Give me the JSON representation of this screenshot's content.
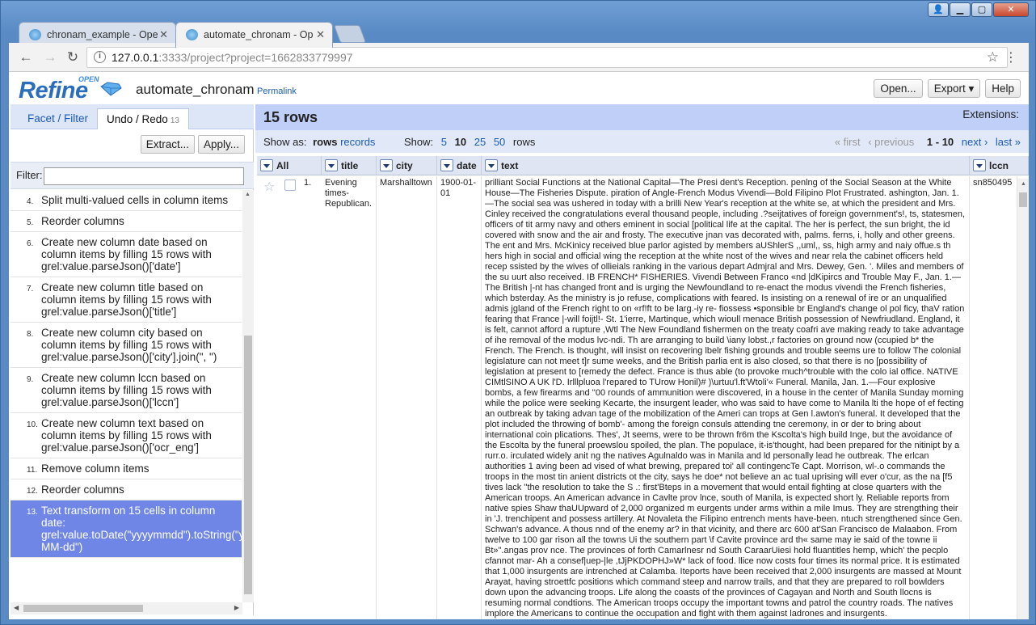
{
  "browser": {
    "tabs": [
      {
        "title": "chronam_example - Ope"
      },
      {
        "title": "automate_chronam - Op"
      }
    ],
    "address": {
      "host": "127.0.0.1",
      "path": ":3333/project?project=1662833779997"
    }
  },
  "header": {
    "logo_text": "Refine",
    "logo_super": "OPEN",
    "project_name": "automate_chronam",
    "permalink": "Permalink",
    "buttons": {
      "open": "Open...",
      "export": "Export ▾",
      "help": "Help"
    }
  },
  "left": {
    "tabs": {
      "facet": "Facet / Filter",
      "undo": "Undo / Redo",
      "undo_count": "13"
    },
    "extract": "Extract...",
    "apply": "Apply...",
    "filter_label": "Filter:",
    "history": [
      {
        "num": "4.",
        "text": "Split multi-valued cells in column items"
      },
      {
        "num": "5.",
        "text": "Reorder columns"
      },
      {
        "num": "6.",
        "text": "Create new column date based on column items by filling 15 rows with grel:value.parseJson()['date']"
      },
      {
        "num": "7.",
        "text": "Create new column title based on column items by filling 15 rows with grel:value.parseJson()['title']"
      },
      {
        "num": "8.",
        "text": "Create new column city based on column items by filling 15 rows with grel:value.parseJson()['city'].join(\", \")"
      },
      {
        "num": "9.",
        "text": "Create new column lccn based on column items by filling 15 rows with grel:value.parseJson()['lccn']"
      },
      {
        "num": "10.",
        "text": "Create new column text based on column items by filling 15 rows with grel:value.parseJson()['ocr_eng']"
      },
      {
        "num": "11.",
        "text": "Remove column items"
      },
      {
        "num": "12.",
        "text": "Reorder columns"
      },
      {
        "num": "13.",
        "text": "Text transform on 15 cells in column date: grel:value.toDate(\"yyyymmdd\").toString(\"yyyy-MM-dd\")"
      }
    ]
  },
  "main": {
    "rows_title": "15 rows",
    "extensions": "Extensions:",
    "show_as_label": "Show as:",
    "show_as_rows": "rows",
    "show_as_records": "records",
    "show_label": "Show:",
    "page_sizes": [
      "5",
      "10",
      "25",
      "50"
    ],
    "page_size_current": "10",
    "rows_word": "rows",
    "pager": {
      "first": "« first",
      "previous": "‹ previous",
      "range": "1 - 10",
      "next": "next ›",
      "last": "last »"
    },
    "columns": {
      "all": "All",
      "title": "title",
      "city": "city",
      "date": "date",
      "text": "text",
      "lccn": "lccn"
    },
    "row1": {
      "index": "1.",
      "title": "Evening times-Republican.",
      "city": "Marshalltown",
      "date": "1900-01-01",
      "lccn": "sn850495",
      "text": "prilliant Social Functions at the National Capital—The Presi dent's Reception. penlng of the Social Season at the White House—The Fisheries Dispute. piration of Angle-French Modus Vivendi—Bold Filipino Plot Frustrated. ashington, Jan. 1.—The social sea was ushered in today with a brilli New Year's reception at the white se, at which the president and Mrs. Cinley received the congratulations everal thousand people, including .?seijtatives of foreign government's!, ts, statesmen, officers of tit army navy and others eminent in social [political life at the capital. The her is perfect, the sun bright, the id covered with snow and the air and frosty. The executive jnan vas decorated with, palms. ferns, i, holly and other greens. The ent and Mrs. McKinicy received blue parlor agisted by members aUShlerS ,,uml,, ss, high army and naiy offue.s th hers high in social and official wing the reception at the white nost of the wives and near rela the cabinet officers held recep ssisted by the wives of ollieials ranking in the various depart Admjral and Mrs. Dewey, Gen. '. Miles and members of the su uurt also received. IB FRENCH* FISHERIES. Vivendi Between Franco «nd |dKipircs and Trouble May F., Jan. 1.—The British |-nt has changed front and is urging the Newfoundland to re-enact the modus vivendi the French fisheries, which bsterday. As the ministry is jo refuse, complications with feared. Is insisting on a renewal of ire or an unqualified admis jgland of the French right to on «rf!ft to be larg.-iy re- fiossess •sponsible br England's change ol pol ficy, thaV ration fearing that France |-will foijtl!- St. 1'ierre, Martinque, which wioull menace British possession of Newfriudland. England, it is felt, cannot afford a rupture ,Wtl The New Foundland fishermen on the treaty coafri ave making ready to take advantage of ihe removal of the modus lvc-ndi. Th are arranging to build \\iany lobst.,r factories on ground now (ccupied b* the French. The French. is thought, will insist on recovering lbelr fishing grounds and trouble seems ure to follow The colonial legislature can not meet t]r sume weeks, and the British parlia ent is also closed, so that there is no [possibility of legislation at present to [remedy the defect. France is thus able (to provoke much^trouble with the colo ial office. NATIVE CIMtlSINO A UK l'D. Irlllpluoa l'repared to TUrow Honil)# )\\urtuu'l.ft'Wtoli'« Funeral. Manila, Jan. 1.—Four explosive bombs, a few firearms and ''00 rounds of ammunition were discovered, in a house in the center of Manila Sunday morning while the police were seeking Kecarte, the insurgent leader, who was said to have come to Manila lti the hope of ef fecting an outbreak by taking advan tage of the mobilization of the Ameri can trops at Gen l.awton's funeral. It developed that the plot included the throwing of bomb'- among the foreign consuls attending tne ceremony, in or der to bring about international coin plications. Thes', Jt seems, were to be thrown fr6m the Kscolta's high build Inge, but the avoidance of the Escolta by the funeral proewslou spoiled, the plan. The populace, it-is'thought, had been prepared for the nitinipt by a rurr.o. irculated widely anit ng the natives Agulnaldo was in Manila and ld personally lead he outbreak. The erlcan authorities 1 aving been ad vised of what brewing, prepared toi' all contingencTe Capt. Morrison, wl-.o commands the troops in the most tin anient districts ot the city, says he doe* not believe an ac tual uprising will ever o'cur, as the na [f5 tives lack ''the resolution to take the S .: first'Bteps in a movement that would entail fighting at close quarters with the American troops. An American advance in Cavlte prov lnce, south of Manila, is expected short ly. Reliable reports from native spies Shaw thaUUpward of 2,000 organized m eurgents under arms within a mile Imus. They are strengthing their in 'J. trenchipent and possess artillery. At Novaleta the Filipino entrench ments have-been. ntuch strengthened since Gen. Schwan's advance. A thous nnd of the enemy ar? in that vicinity, and there arc 600 at'San Francisco de Malaabon. From twelve to 100 gar rison all the towns Ui the southern part \\f Cavite province ard th« same may ie said of the towne ii Bt»\".angas prov nce. The provinces of forth Camarlnesr nd South CaraarUiesi hold fluantitles hemp, which' the pecplo cfannot mar- Ah a consef|uep-|le ,tJjPKDOPHJ»W* lack of food. llice now costs four times its normal price. It is estimated that 1,000 insurgents are intrenched at Calamba. Iteports have been received that 2,000 insurgents are massed at Mount Arayat, having stroettfc positions which command steep and narrow trails, and that they are prepared to roll bowlders down upon the advancing troops. Life along the coasts of the provinces of Cagayan and North and South llocns is resuming normal condtions. The American troops occupy the important towns and patrol the country roads. The natives implore the Americans to continue the occupation and fight with them against ladrones and insurgents."
    }
  }
}
